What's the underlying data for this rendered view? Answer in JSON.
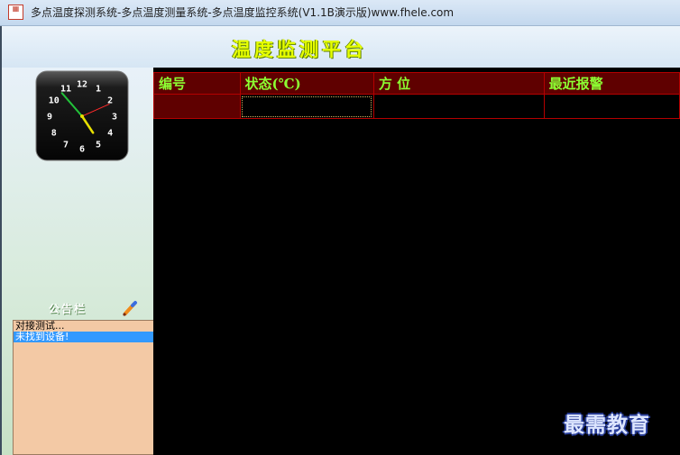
{
  "window": {
    "title": "多点温度探测系统-多点温度测量系统-多点温度监控系统(V1.1B演示版)www.fhele.com",
    "icon": "app-logo-icon"
  },
  "header": {
    "title": "温度监测平台"
  },
  "clock": {
    "numbers": [
      "12",
      "1",
      "2",
      "3",
      "4",
      "5",
      "6",
      "7",
      "8",
      "9",
      "10",
      "11"
    ],
    "time": "04:53:11"
  },
  "notice_board": {
    "title": "公告栏",
    "edit_icon": "pencil-icon"
  },
  "log": {
    "lines": [
      "对接测试...",
      "未找到设备!"
    ],
    "selected_index": 1
  },
  "grid": {
    "columns": [
      "编号",
      "状态(℃)",
      "方 位",
      "最近报警"
    ],
    "rows": [
      [
        "",
        "",
        "",
        ""
      ]
    ]
  },
  "watermark": "最需教育",
  "colors": {
    "grid_background": "#000000",
    "header_background": "#5f0000",
    "header_text": "#8cff32",
    "grid_border": "#b40000",
    "title_text": "#e6ff00",
    "log_background": "#f3c9a5",
    "selection": "#3399ff"
  }
}
